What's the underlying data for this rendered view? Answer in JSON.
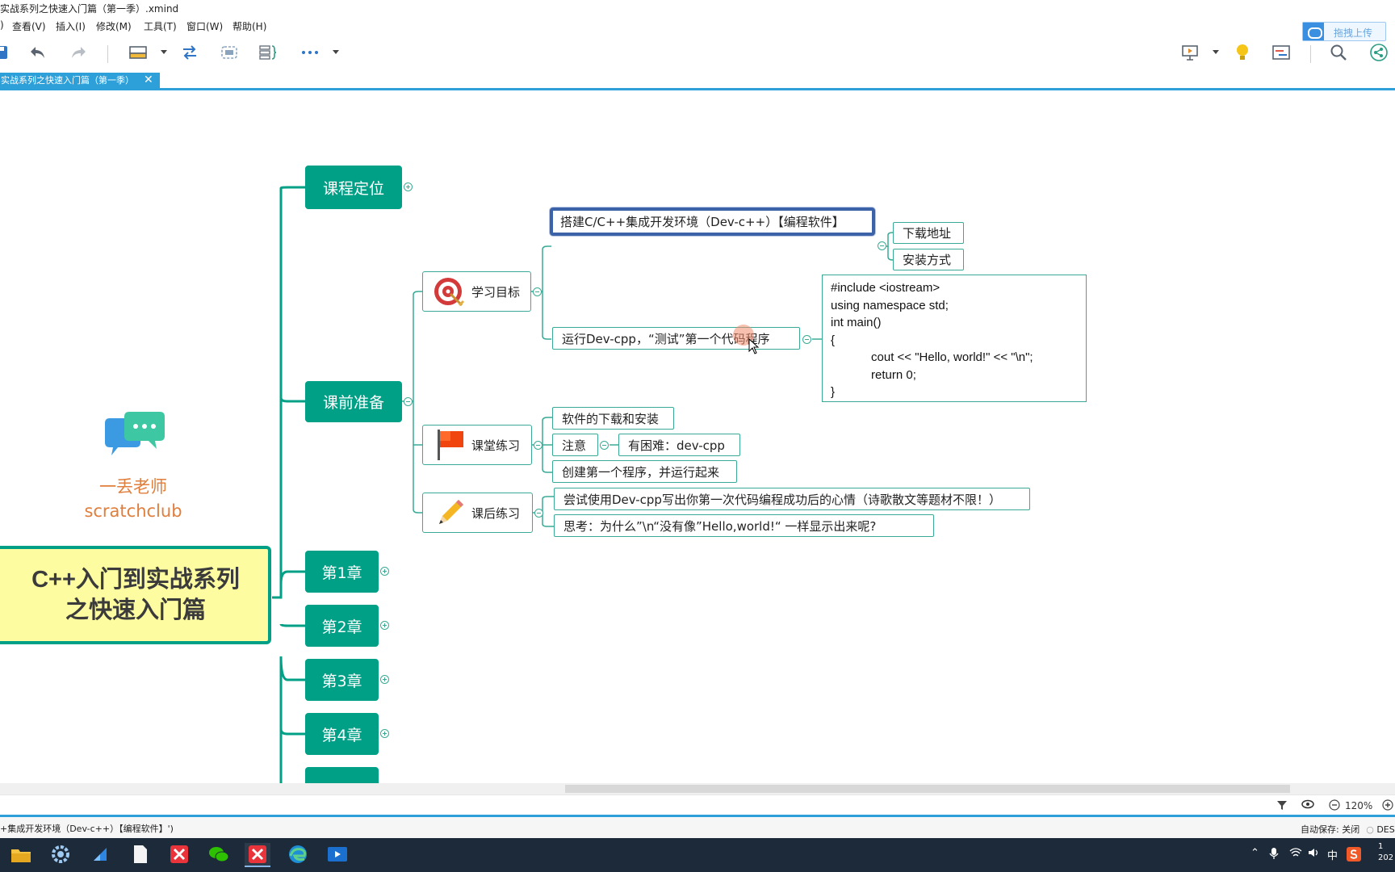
{
  "window": {
    "title": "实战系列之快速入门篇（第一季）.xmind"
  },
  "menu": {
    "items": [
      "查看(V)",
      "插入(I)",
      "修改(M)",
      "工具(T)",
      "窗口(W)",
      "帮助(H)"
    ]
  },
  "upload_button": {
    "label": "拖拽上传"
  },
  "tab": {
    "label": "实战系列之快速入门篇（第一季）",
    "close": "✕"
  },
  "mindmap": {
    "root": {
      "line1": "C++入门到实战系列",
      "line2": "之快速入门篇"
    },
    "teacher": {
      "name": "一丢老师",
      "brand": "scratchclub"
    },
    "main_topics": [
      "课程定位",
      "课前准备",
      "第1章",
      "第2章",
      "第3章",
      "第4章"
    ],
    "subtopics": {
      "learning_goal": "学习目标",
      "class_practice": "课堂练习",
      "homework": "课后练习"
    },
    "leaves": {
      "setup_env": "搭建C/C++集成开发环境（Dev-c++）【编程软件】",
      "download_url": "下载地址",
      "install_method": "安装方式",
      "run_devcpp": "运行Dev-cpp，“测试”第一个代码程序",
      "software_download": "软件的下载和安装",
      "attention": "注意",
      "difficulty": "有困难：dev-cpp",
      "create_first": "创建第一个程序，并运行起来",
      "try_devcpp": "尝试使用Dev-cpp写出你第一次代码编程成功后的心情（诗歌散文等题材不限！）",
      "think": "思考：为什么”\\n“没有像”Hello,world!“ 一样显示出来呢?"
    },
    "code_lines": [
      "#include <iostream>",
      "using namespace std;",
      "int main()",
      "{",
      "            cout << \"Hello, world!\" << \"\\n\";",
      "            return 0;",
      "}"
    ]
  },
  "view": {
    "zoom": "120%"
  },
  "status": {
    "left_text": "+集成开发环境（Dev-c++）【编程软件】')",
    "autosave": "自动保存: 关闭",
    "device": "DESK"
  },
  "tray": {
    "ime": "中"
  },
  "colors": {
    "topic_green": "#00a087",
    "root_fill": "#fdfca0",
    "tab_blue": "#2d9fd9",
    "selection_blue": "#3c62a8",
    "teacher_orange": "#e07e3c"
  },
  "icons": [
    "undo-icon",
    "redo-icon",
    "target-icon",
    "flag-icon",
    "pencil-icon",
    "chat-bubbles-icon",
    "lightbulb-icon",
    "search-icon",
    "share-icon"
  ]
}
